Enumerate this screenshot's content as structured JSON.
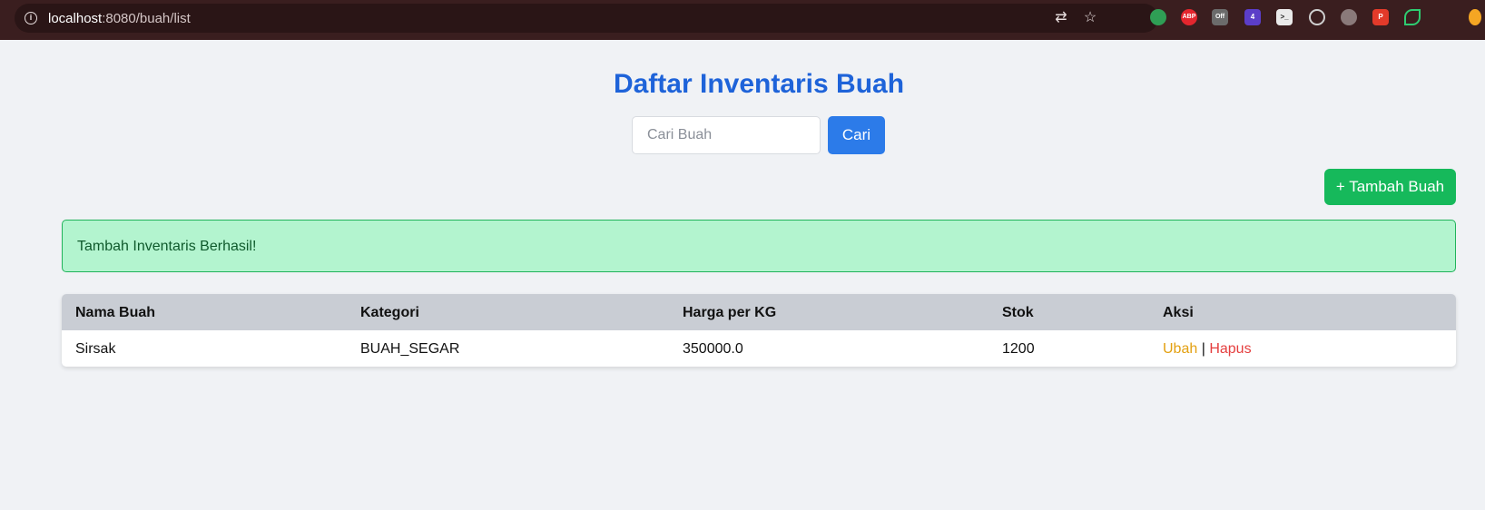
{
  "browser": {
    "url_host": "localhost",
    "url_path": ":8080/buah/list",
    "extensions": [
      {
        "name": "android-extension-icon",
        "color": "#2f9e55",
        "label": "",
        "badge": ""
      },
      {
        "name": "adblock-plus-icon",
        "color": "#e3262e",
        "label": "ABP",
        "badge": ""
      },
      {
        "name": "off-toggle-extension-icon",
        "color": "#6b6b6b",
        "label": "Off",
        "badge": ""
      },
      {
        "name": "counter-extension-icon",
        "color": "#5b3ec8",
        "label": "4",
        "badge": "4"
      },
      {
        "name": "terminal-extension-icon",
        "color": "#eaeaea",
        "label": ">_",
        "badge": ""
      },
      {
        "name": "target-extension-icon",
        "color": "#cfcfcf",
        "label": "",
        "badge": ""
      },
      {
        "name": "robot-extension-icon",
        "color": "#8a7a7a",
        "label": "",
        "badge": ""
      },
      {
        "name": "pdf-extension-icon",
        "color": "#e23a2a",
        "label": "P",
        "badge": ""
      },
      {
        "name": "eye-extension-icon",
        "color": "#2ecc71",
        "label": "",
        "badge": ""
      },
      {
        "name": "orange-extension-icon",
        "color": "#f5a623",
        "label": "",
        "badge": ""
      }
    ]
  },
  "page": {
    "title": "Daftar Inventaris Buah",
    "search": {
      "placeholder": "Cari Buah",
      "value": "",
      "button_label": "Cari"
    },
    "add_button_label": "+ Tambah Buah",
    "alert_message": "Tambah Inventaris Berhasil!",
    "table": {
      "headers": [
        "Nama Buah",
        "Kategori",
        "Harga per KG",
        "Stok",
        "Aksi"
      ],
      "rows": [
        {
          "nama": "Sirsak",
          "kategori": "BUAH_SEGAR",
          "harga": "350000.0",
          "stok": "1200",
          "edit_label": "Ubah",
          "separator": "|",
          "delete_label": "Hapus"
        }
      ]
    }
  },
  "colors": {
    "title": "#1e63d9",
    "search_button": "#2c7be9",
    "add_button": "#16b95b",
    "alert_bg": "#b3f4cf",
    "alert_border": "#20b35a",
    "edit_link": "#e3a011",
    "delete_link": "#e53e3e"
  }
}
